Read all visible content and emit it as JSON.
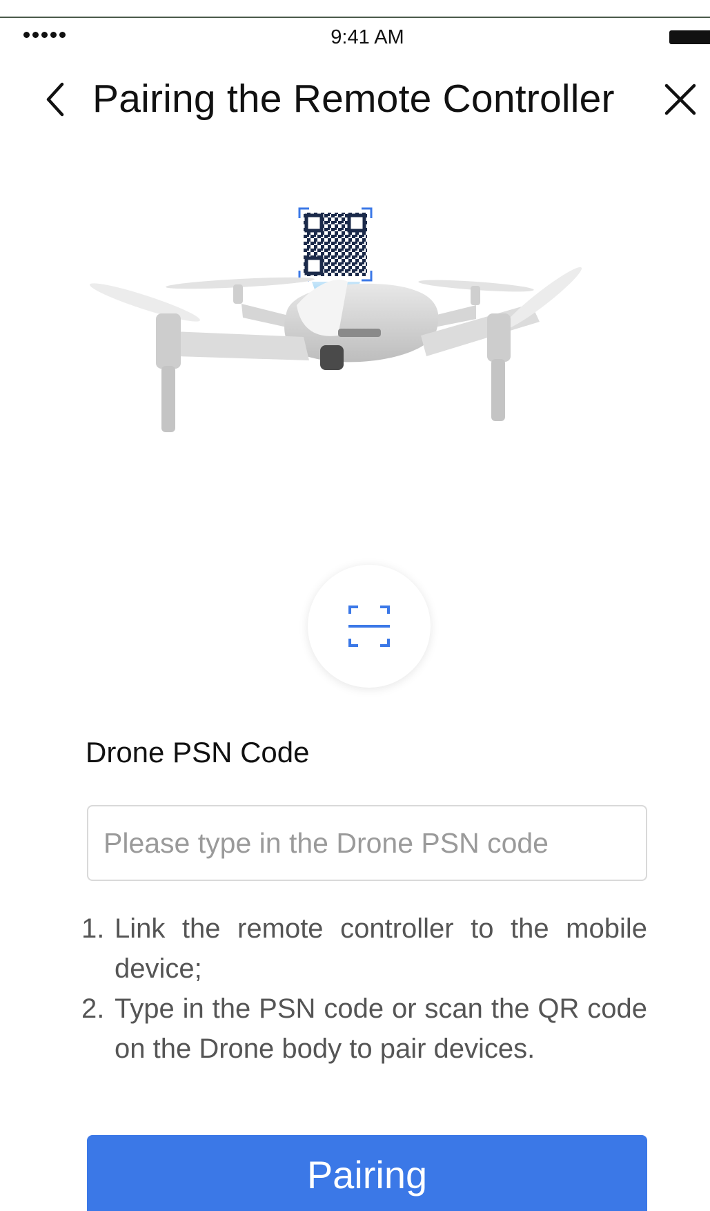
{
  "status_bar": {
    "time": "9:41 AM",
    "signal_icon": "signal-dots-icon",
    "battery_icon": "battery-icon"
  },
  "nav": {
    "title": "Pairing the Remote Controller",
    "back_icon": "chevron-left-icon",
    "close_icon": "close-icon"
  },
  "hero": {
    "icon": "drone-with-qr-code-illustration"
  },
  "scan": {
    "icon": "scan-qr-icon",
    "accent": "#3b78e7"
  },
  "form": {
    "label": "Drone PSN Code",
    "value": "",
    "placeholder": "Please type in the Drone PSN code"
  },
  "instructions": [
    {
      "num": "1.",
      "text": "Link the remote controller to the mobile device;"
    },
    {
      "num": "2.",
      "text": "Type in the PSN code or scan the QR code on the Drone body to pair devices."
    }
  ],
  "pair_button": {
    "label": "Pairing",
    "color": "#3b78e7"
  }
}
